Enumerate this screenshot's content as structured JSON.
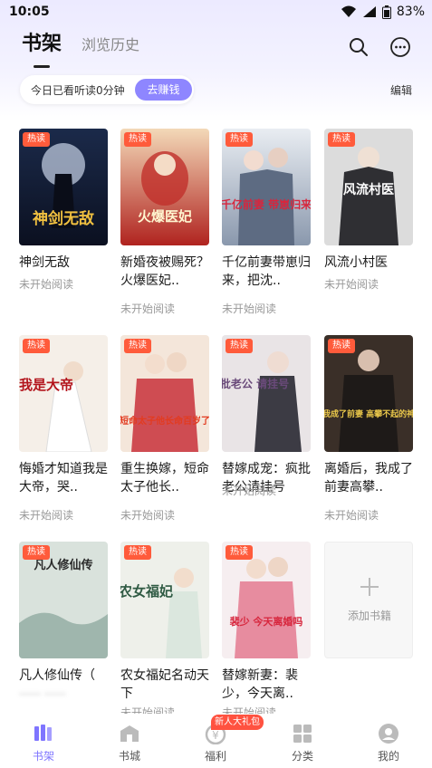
{
  "status": {
    "time": "10:05",
    "battery": "83%"
  },
  "header": {
    "tab_shelf": "书架",
    "tab_history": "浏览历史"
  },
  "reading": {
    "text": "今日已看听读0分钟",
    "earn": "去赚钱",
    "edit": "编辑"
  },
  "badge_hot": "热读",
  "books": [
    {
      "title": "神剑无敌",
      "status": "未开始阅读",
      "cover_text": "神剑无敌"
    },
    {
      "title": "新婚夜被赐死？火爆医妃..",
      "status": "未开始阅读",
      "cover_text": "火爆医妃"
    },
    {
      "title": "千亿前妻带崽归来，把沈..",
      "status": "未开始阅读",
      "cover_text": "千亿前妻 带崽归来"
    },
    {
      "title": "风流小村医",
      "status": "未开始阅读",
      "cover_text": "风流村医"
    },
    {
      "title": "悔婚才知道我是大帝，哭..",
      "status": "未开始阅读",
      "cover_text": "我是大帝"
    },
    {
      "title": "重生换嫁，短命太子他长..",
      "status": "未开始阅读",
      "cover_text": "短命太子他长命百岁了"
    },
    {
      "title": "替嫁成宠：疯批老公请挂号",
      "status": "未开始阅读",
      "cover_text": "疯批老公 请挂号"
    },
    {
      "title": "离婚后，我成了前妻高攀..",
      "status": "未开始阅读",
      "cover_text": "我成了前妻 高攀不起的神"
    },
    {
      "title": "凡人修仙传（",
      "title_blurred": "……  ……",
      "status": "",
      "cover_text": "凡人修仙传"
    },
    {
      "title": "农女福妃名动天下",
      "status": "未开始阅读",
      "cover_text": "农女福妃"
    },
    {
      "title": "替嫁新妻：裴少，今天离..",
      "status": "未开始阅读",
      "cover_text": "裴少 今天离婚吗"
    }
  ],
  "add_book": "添加书籍",
  "nav": {
    "shelf": "书架",
    "store": "书城",
    "welfare": "福利",
    "category": "分类",
    "mine": "我的",
    "gift_badge": "新人大礼包"
  },
  "colors": {
    "accent": "#8e86ff",
    "hot": "#ff5b3b"
  }
}
